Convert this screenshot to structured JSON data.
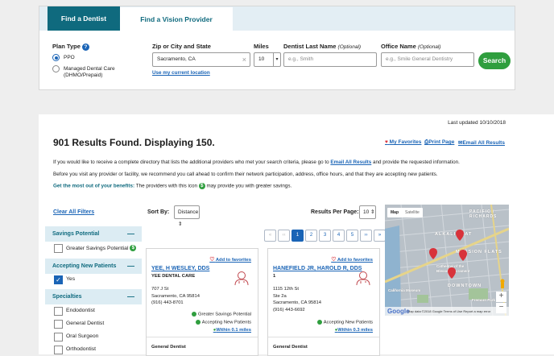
{
  "tabs": {
    "dentist": "Find a Dentist",
    "vision": "Find a Vision Provider"
  },
  "search": {
    "plan_type_label": "Plan Type",
    "plan_options": [
      "PPO",
      "Managed Dental Care",
      "(DHMO/Prepaid)"
    ],
    "zip_label": "Zip or City and State",
    "zip_value": "Sacramento, CA",
    "use_location": "Use my current location",
    "miles_label": "Miles",
    "miles_value": "10",
    "last_name_label": "Dentist Last Name",
    "optional": "(Optional)",
    "last_name_placeholder": "e.g., Smith",
    "office_label": "Office Name",
    "office_placeholder": "e.g., Smile General Dentistry",
    "search_button": "Search"
  },
  "results": {
    "last_updated": "Last updated 10/10/2018",
    "title": "901 Results Found. Displaying 150.",
    "my_favorites": "My Favorites",
    "print_page": "Print Page",
    "email_all": "Email All Results",
    "para1_a": "If you would like to receive a complete directory that lists the additional providers who met your search criteria, please go to",
    "para1_link": "Email All Results",
    "para1_b": "and provide the requested information.",
    "para2": "Before you visit any provider or facility, we recommend you call ahead to confirm their network participation, address, office hours, and that they are accepting new patients.",
    "para3_bold": "Get the most out of your benefits:",
    "para3_a": "The providers with this icon",
    "para3_b": "may provide you with greater savings."
  },
  "filters": {
    "clear": "Clear All Filters",
    "savings_head": "Savings Potential",
    "savings_opt": "Greater Savings Potential",
    "accepting_head": "Accepting New Patients",
    "accepting_opt": "Yes",
    "specialties_head": "Specialties",
    "specialties": [
      "Endodontist",
      "General Dentist",
      "Oral Surgeon",
      "Orthodontist"
    ]
  },
  "controls": {
    "sort_label": "Sort By:",
    "sort_value": "Distance",
    "per_page_label": "Results Per Page:",
    "per_page_value": "10",
    "pages": [
      "1",
      "2",
      "3",
      "4",
      "5"
    ]
  },
  "cards": [
    {
      "favorite": "Add to favorites",
      "name": "YEE, H WESLEY, DDS",
      "practice": "YEE DENTAL CARE",
      "addr1": "707 J St",
      "addr2": "Sacramento, CA 95814",
      "phone": "(916) 443-8701",
      "badge1": "Greater Savings Potential",
      "badge2": "Accepting New Patients",
      "distance": "Within 0.1 miles",
      "specialty": "General Dentist"
    },
    {
      "favorite": "Add to favorites",
      "name": "HANEFIELD JR, HAROLD R, DDS",
      "practice": "1",
      "addr1": "1115 12th St",
      "addr2": "Ste 2a",
      "addr3": "Sacramento, CA 95814",
      "phone": "(916) 443-6692",
      "badge2": "Accepting New Patients",
      "distance": "Within 0.3 miles",
      "specialty": "General Dentist"
    }
  ],
  "map": {
    "tab_map": "Map",
    "tab_sat": "Satellite",
    "labels": [
      "ALKALI FLAT",
      "MANSION FLATS",
      "DOWNTOWN",
      "PACIFIC / RICHARDS",
      "Cathedral of the Blessed Sacrament",
      "California Museum",
      "Fremont Park"
    ],
    "footer": "Map data ©2018 Google   Terms of Use   Report a map error",
    "google": "Google"
  },
  "colors": {
    "brand": "#0f6a7e",
    "link": "#1a64b6",
    "search_green": "#2f9e3e",
    "heart": "#d8333b"
  }
}
